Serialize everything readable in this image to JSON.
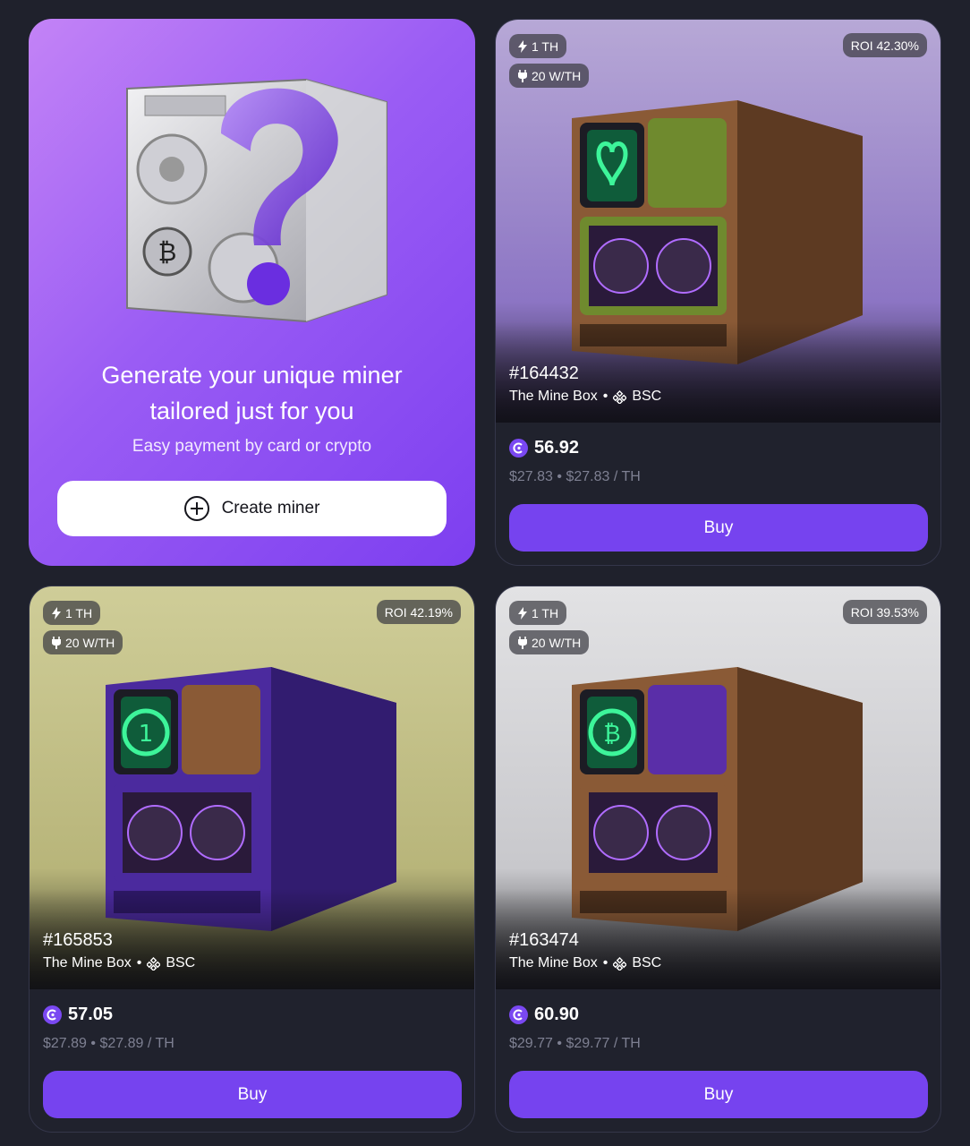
{
  "promo": {
    "title_line1": "Generate your unique miner",
    "title_line2": "tailored just for you",
    "subtitle": "Easy payment by card or crypto",
    "button_label": "Create miner",
    "button_icon": "plus-circle-icon"
  },
  "cards": [
    {
      "hashrate": "1 TH",
      "efficiency": "20 W/TH",
      "roi": "ROI 42.30%",
      "id": "#164432",
      "collection": "The Mine Box",
      "separator": "•",
      "network": "BSC",
      "price": "56.92",
      "usd_price": "$27.83",
      "usd_per_th": "$27.83 / TH",
      "buy_label": "Buy",
      "theme": "lavender"
    },
    {
      "hashrate": "1 TH",
      "efficiency": "20 W/TH",
      "roi": "ROI 42.19%",
      "id": "#165853",
      "collection": "The Mine Box",
      "separator": "•",
      "network": "BSC",
      "price": "57.05",
      "usd_price": "$27.89",
      "usd_per_th": "$27.89 / TH",
      "buy_label": "Buy",
      "theme": "olive"
    },
    {
      "hashrate": "1 TH",
      "efficiency": "20 W/TH",
      "roi": "ROI 39.53%",
      "id": "#163474",
      "collection": "The Mine Box",
      "separator": "•",
      "network": "BSC",
      "price": "60.90",
      "usd_price": "$29.77",
      "usd_per_th": "$29.77 / TH",
      "buy_label": "Buy",
      "theme": "grey"
    }
  ],
  "colors": {
    "background": "#1f212c",
    "accent": "#7643ef",
    "promo_gradient_start": "#c383f6",
    "promo_gradient_end": "#7d3ff0"
  }
}
